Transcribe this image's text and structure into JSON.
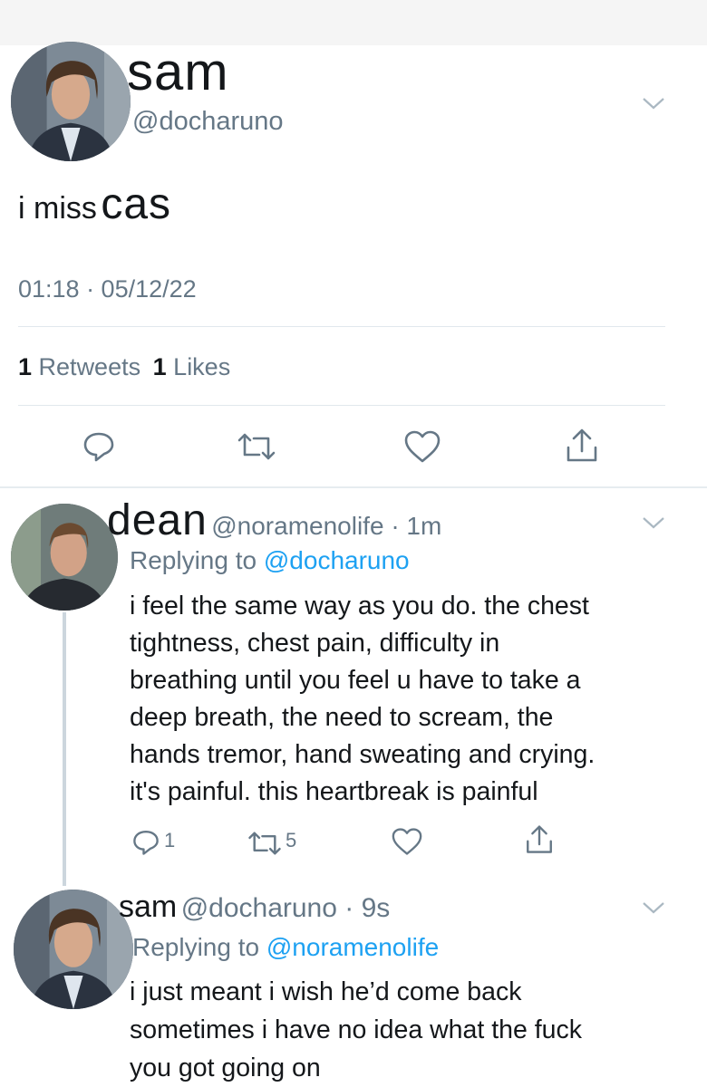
{
  "main_tweet": {
    "display_name": "sam",
    "handle": "@docharuno",
    "text_prefix": "i miss",
    "text_emphasis": "cas",
    "timestamp": "01:18 · 05/12/22",
    "retweets_count": "1",
    "retweets_label": "Retweets",
    "likes_count": "1",
    "likes_label": "Likes",
    "actions": [
      "reply-icon",
      "retweet-icon",
      "like-icon",
      "share-icon"
    ]
  },
  "reply_1": {
    "display_name": "dean",
    "meta": "@noramenolife · 1m",
    "replying_prefix": "Replying to",
    "replying_to": "@docharuno",
    "lines": [
      "i feel the same way as you do. the chest",
      "tightness, chest pain, difficulty in",
      "breathing until you feel u have to take a",
      "deep breath, the need to scream, the",
      "hands tremor, hand sweating and crying.",
      "it's painful. this heartbreak is painful"
    ],
    "reply_count": "1",
    "retweet_count": "5"
  },
  "reply_2": {
    "display_name": "sam",
    "meta": "@docharuno · 9s",
    "replying_prefix": "Replying to",
    "replying_to": "@noramenolife",
    "lines": [
      "i just meant i wish he’d come back",
      "sometimes i have no idea what the fuck",
      "you got going on"
    ]
  },
  "colors": {
    "link": "#1da1f2",
    "secondary_text": "#657786",
    "divider": "#e1e8ed"
  }
}
